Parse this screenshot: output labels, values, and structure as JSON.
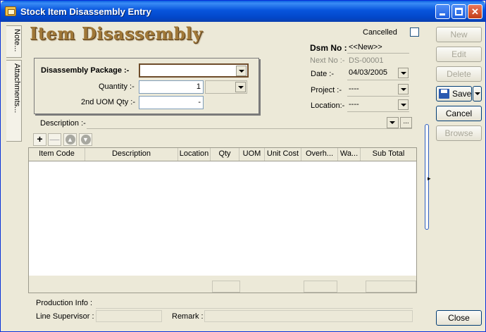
{
  "window": {
    "title": "Stock Item Disassembly Entry"
  },
  "side_tabs": {
    "notes": "Note...",
    "attachments": "Attachments..."
  },
  "heading": "Item Disassembly",
  "cancelled": {
    "label": "Cancelled",
    "checked": false
  },
  "header_right": {
    "dsm_no_label": "Dsm No :",
    "dsm_no_value": "<<New>>",
    "next_no_label": "Next No :-",
    "next_no_value": "DS-00001",
    "date_label": "Date :-",
    "date_value": "04/03/2005",
    "project_label": "Project :-",
    "project_value": "----",
    "location_label": "Location:-",
    "location_value": "----"
  },
  "package": {
    "package_label": "Disassembly Package :-",
    "package_value": "",
    "quantity_label": "Quantity :-",
    "quantity_value": "1",
    "uom_value": "",
    "uom2_label": "2nd UOM Qty :-",
    "uom2_value": "-"
  },
  "description": {
    "label": "Description :-",
    "value": "",
    "more_label": "..."
  },
  "grid": {
    "columns": [
      "Item Code",
      "Description",
      "Location",
      "Qty",
      "UOM",
      "Unit Cost",
      "Overh...",
      "Wa...",
      "Sub Total"
    ],
    "rows": []
  },
  "bottom": {
    "production_info_label": "Production Info :",
    "line_supervisor_label": "Line Supervisor :",
    "remark_label": "Remark :"
  },
  "buttons": {
    "new": "New",
    "edit": "Edit",
    "delete": "Delete",
    "save": "Save",
    "cancel": "Cancel",
    "browse": "Browse",
    "close": "Close"
  }
}
